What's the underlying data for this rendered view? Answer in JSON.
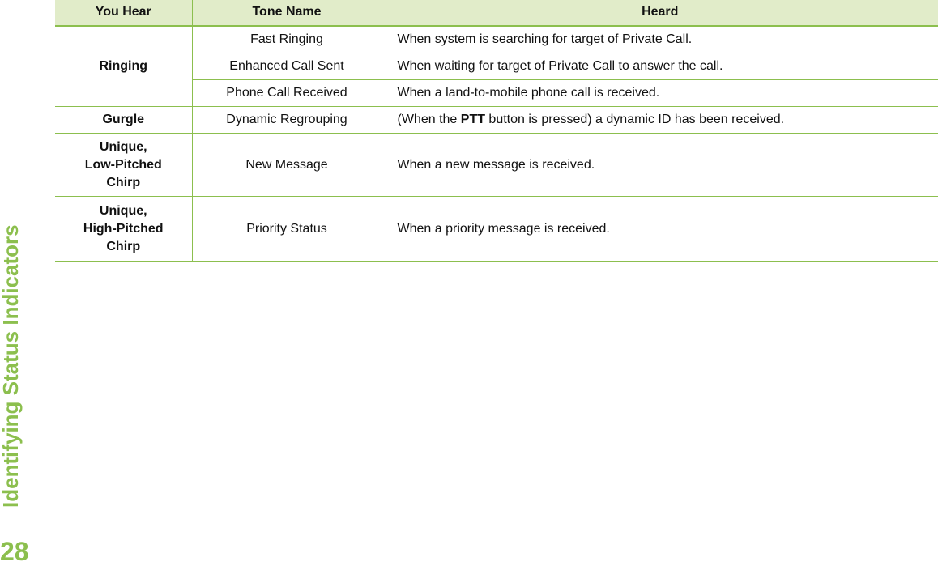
{
  "sidebar": {
    "section_title": "Identifying Status Indicators",
    "page_number": "28"
  },
  "colors": {
    "accent": "#8cbf4e",
    "header_bg": "#e1ecc9"
  },
  "table": {
    "headers": [
      "You Hear",
      "Tone Name",
      "Heard"
    ],
    "rows": [
      {
        "you_hear": "Ringing",
        "tone_name": "Fast Ringing",
        "heard": "When system is searching for target of Private Call."
      },
      {
        "you_hear": "",
        "tone_name": "Enhanced Call Sent",
        "heard": "When waiting for target of Private Call to answer the call."
      },
      {
        "you_hear": "",
        "tone_name": "Phone Call Received",
        "heard": "When a land-to-mobile phone call is received."
      },
      {
        "you_hear": "Gurgle",
        "tone_name": "Dynamic Regrouping",
        "heard_prefix": "(When the ",
        "heard_bold": "PTT",
        "heard_suffix": " button is pressed) a dynamic ID has been received."
      },
      {
        "you_hear_lines": [
          "Unique,",
          "Low-Pitched",
          "Chirp"
        ],
        "tone_name": "New Message",
        "heard": "When a new message is received."
      },
      {
        "you_hear_lines": [
          "Unique,",
          "High-Pitched",
          "Chirp"
        ],
        "tone_name": "Priority Status",
        "heard": "When a priority message is received."
      }
    ]
  }
}
